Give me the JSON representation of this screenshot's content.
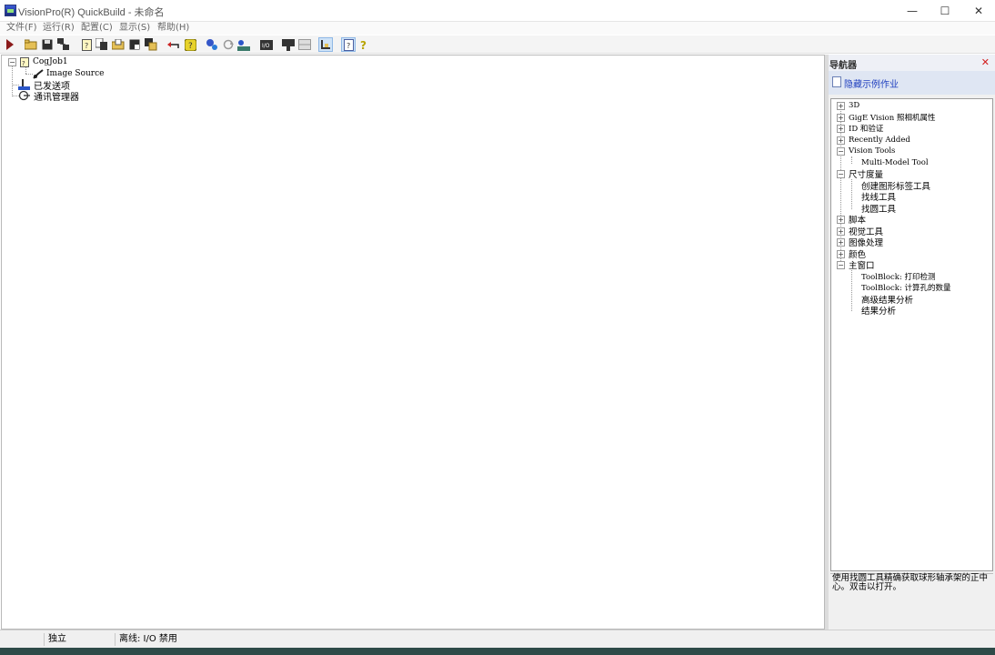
{
  "window": {
    "title": "VisionPro(R) QuickBuild - 未命名",
    "controls": {
      "minimize": "—",
      "maximize": "☐",
      "close": "✕"
    }
  },
  "menu": [
    {
      "label": "文件(F)"
    },
    {
      "label": "运行(R)"
    },
    {
      "label": "配置(C)"
    },
    {
      "label": "显示(S)"
    },
    {
      "label": "帮助(H)"
    }
  ],
  "toolbar": {
    "buttons": [
      {
        "icon": "run-icon"
      },
      {
        "icon": "open-folder-icon"
      },
      {
        "icon": "save-icon"
      },
      {
        "icon": "network-icon"
      },
      {
        "icon": "new-job-icon"
      },
      {
        "icon": "copy-job-icon"
      },
      {
        "icon": "open-job-icon"
      },
      {
        "icon": "save-job-icon"
      },
      {
        "icon": "save-all-icon"
      },
      {
        "icon": "undo-icon"
      },
      {
        "icon": "help-job-icon"
      },
      {
        "icon": "settings-icon"
      },
      {
        "icon": "refresh-icon"
      },
      {
        "icon": "posting-icon"
      },
      {
        "icon": "io-icon"
      },
      {
        "icon": "display-icon"
      },
      {
        "icon": "grid-icon"
      },
      {
        "icon": "tool-icon"
      },
      {
        "icon": "navigator-icon"
      },
      {
        "icon": "help-icon"
      }
    ]
  },
  "job_tree": {
    "root": {
      "label": "CogJob1",
      "child": "Image Source"
    },
    "posted_items": "已发送项",
    "comm_manager": "通讯管理器"
  },
  "navigator": {
    "title": "导航器",
    "close": "✕",
    "link": "隐藏示例作业",
    "tree": [
      {
        "label": "3D",
        "expander": "+"
      },
      {
        "label": "GigE Vision 照相机属性",
        "expander": "+"
      },
      {
        "label": "ID 和验证",
        "expander": "+"
      },
      {
        "label": "Recently Added",
        "expander": "+"
      },
      {
        "label": "Vision Tools",
        "expander": "−"
      },
      {
        "label": "Multi-Model Tool"
      },
      {
        "label": "尺寸度量",
        "expander": "−"
      },
      {
        "label": "创建图形标签工具"
      },
      {
        "label": "找线工具"
      },
      {
        "label": "找圆工具"
      },
      {
        "label": "脚本",
        "expander": "+"
      },
      {
        "label": "视觉工具",
        "expander": "+"
      },
      {
        "label": "图像处理",
        "expander": "+"
      },
      {
        "label": "颜色",
        "expander": "+"
      },
      {
        "label": "主窗口",
        "expander": "−"
      },
      {
        "label": "ToolBlock: 打印检测"
      },
      {
        "label": "ToolBlock: 计算孔的数量"
      },
      {
        "label": "高级结果分析"
      },
      {
        "label": "结果分析"
      }
    ],
    "description": "使用找圆工具精确获取球形轴承架的正中心。双击以打开。"
  },
  "status": {
    "mode": "独立",
    "io": "离线: I/O 禁用"
  },
  "colors": {
    "run": "#8b1a1a",
    "link": "#1f3fbf",
    "nav_close": "#d21b1b",
    "taskbar": "#2e4a48"
  }
}
